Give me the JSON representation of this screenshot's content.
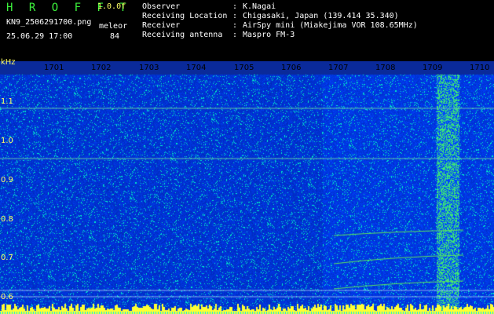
{
  "header": {
    "app_title": "H R O F F T",
    "version": "1.0.0f",
    "filename": "KN9_2506291700.png",
    "meteor_label": "meleor",
    "datetime": "25.06.29 17:00",
    "meteor_count": "84",
    "info": [
      {
        "label": "Observer",
        "value": "K.Nagai"
      },
      {
        "label": "Receiving Location",
        "value": "Chigasaki, Japan (139.414 35.340)"
      },
      {
        "label": "Receiver",
        "value": "AirSpy mini (Miakejima VOR 108.65MHz)"
      },
      {
        "label": "Receiving antenna",
        "value": "Maspro FM-3"
      }
    ],
    "separator": ":"
  },
  "axes": {
    "y_unit": "kHz",
    "y_ticks": [
      "1.1",
      "1.0",
      "0.9",
      "0.8",
      "0.7",
      "0.6"
    ],
    "x_ticks": [
      "1701",
      "1702",
      "1703",
      "1704",
      "1705",
      "1706",
      "1707",
      "1708",
      "1709",
      "1710"
    ]
  },
  "colors": {
    "background": "#000000",
    "noise": "#0a2fb4",
    "trace": "#5ce65c",
    "label_yellow": "#ffff66",
    "header_green": "#3cf23c"
  }
}
